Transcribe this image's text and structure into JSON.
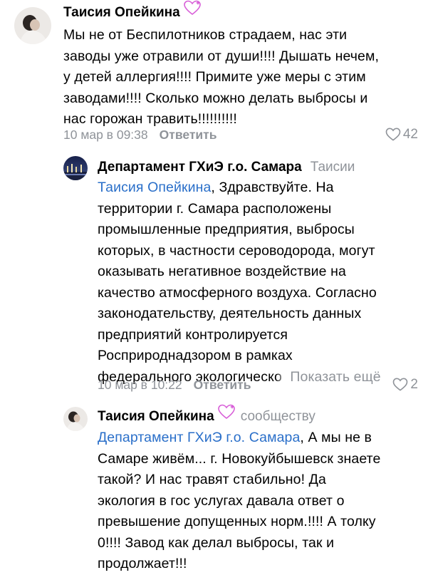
{
  "comments": [
    {
      "author": "Таисия Опейкина",
      "lines": [
        "Мы не от Беспилотников страдаем, нас эти",
        "заводы уже отравили от души!!!! Дышать нечем,",
        "у детей аллергия!!!! Примите уже меры с этим",
        "заводами!!!! Сколько можно делать выбросы и",
        "нас горожан травить!!!!!!!!!!"
      ],
      "date": "10 мар в 09:38",
      "reply_label": "Ответить",
      "likes": "42"
    },
    {
      "author": "Департамент ГХиЭ г.о. Самара",
      "reply_to": "Таисии",
      "mention": "Таисия Опейкина",
      "first_line_rest": ", Здравствуйте. На",
      "lines": [
        "территории г. Самара расположены",
        "промышленные предприятия, выбросы",
        "которых, в частности сероводорода, могут",
        "оказывать негативное воздействие на",
        "качество атмосферного воздуха. Согласно",
        "законодательству, деятельность данных",
        "предприятий контролируется",
        "Росприроднадзором в рамках"
      ],
      "last_line": "федерального экологическо",
      "show_more": "Показать ещё",
      "date": "10 мар в 10:22",
      "reply_label": "Ответить",
      "likes": "2"
    },
    {
      "author": "Таисия Опейкина",
      "reply_to": "сообществу",
      "mention": "Департамент ГХиЭ г.о. Самара",
      "first_line_rest": ", А мы не в",
      "lines": [
        "Самаре живём... г. Новокуйбышевск знаете",
        "такой? И нас травят стабильно! Да",
        "экология в гос услугах давала ответ о",
        "превышение допущенных норм.!!!! А толку",
        "0!!!! Завод как делал выбросы, так и",
        "продолжает!!!"
      ]
    }
  ],
  "colors": {
    "link": "#2a6fc9",
    "muted": "#8f9399",
    "badge": "#d85fd8"
  },
  "icons": [
    "heart-badge-icon",
    "heart-outline-icon"
  ]
}
